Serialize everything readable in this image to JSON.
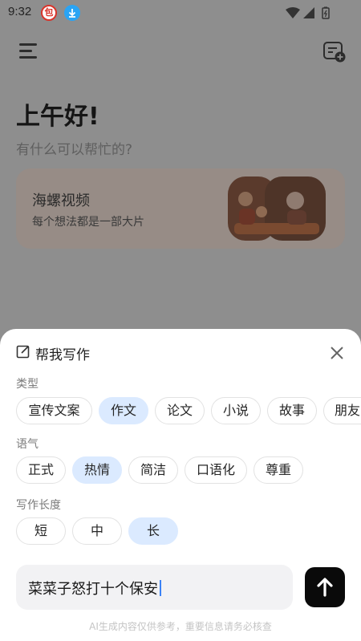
{
  "status_bar": {
    "time": "9:32",
    "badge_red_text": "包",
    "icons": [
      "app-notification-icon",
      "download-icon",
      "wifi-icon",
      "signal-icon",
      "battery-icon"
    ]
  },
  "app": {
    "greeting": "上午好!",
    "subgreeting": "有什么可以帮忙的?",
    "feature_card": {
      "title": "海螺视频",
      "subtitle": "每个想法都是一部大片"
    }
  },
  "sheet": {
    "title": "帮我写作",
    "type_label": "类型",
    "types": [
      "宣传文案",
      "作文",
      "论文",
      "小说",
      "故事",
      "朋友"
    ],
    "type_selected": "作文",
    "tone_label": "语气",
    "tones": [
      "正式",
      "热情",
      "简洁",
      "口语化",
      "尊重"
    ],
    "tone_selected": "热情",
    "length_label": "写作长度",
    "lengths": [
      "短",
      "中",
      "长"
    ],
    "length_selected": "长",
    "input_value": "菜菜子怒打十个保安",
    "disclaimer": "AI生成内容仅供参考，重要信息请务必核查"
  },
  "colors": {
    "selected_chip": "#dbeaff",
    "send_button": "#0a0a0a",
    "caret": "#3b82f6"
  }
}
